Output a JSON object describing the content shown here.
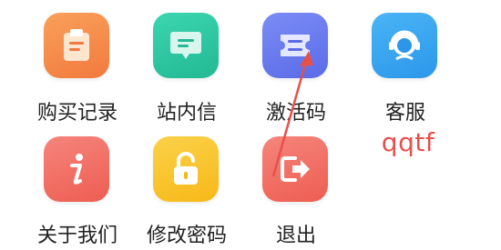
{
  "menu": {
    "items": [
      {
        "label": "购买记录",
        "icon": "clipboard-icon",
        "color": "#f5894a"
      },
      {
        "label": "站内信",
        "icon": "message-icon",
        "color": "#2ec9a4"
      },
      {
        "label": "激活码",
        "icon": "ticket-icon",
        "color": "#6a7cf0"
      },
      {
        "label": "客服",
        "icon": "headset-agent-icon",
        "color": "#3aa6f0"
      },
      {
        "label": "关于我们",
        "icon": "info-icon",
        "color": "#f06a5f"
      },
      {
        "label": "修改密码",
        "icon": "unlock-icon",
        "color": "#f9c52e"
      },
      {
        "label": "退出",
        "icon": "logout-icon",
        "color": "#f06a5f"
      }
    ]
  },
  "annotation": {
    "text": "qqtf",
    "color": "#e8504a"
  }
}
